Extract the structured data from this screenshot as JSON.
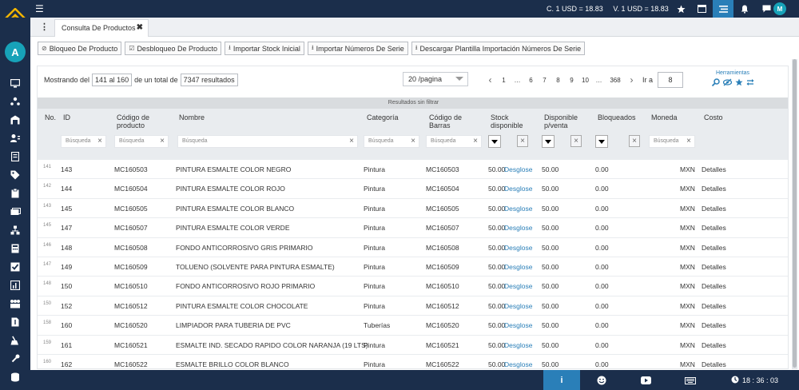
{
  "header": {
    "rate_c": "C. 1 USD = 18.83",
    "rate_v": "V. 1 USD = 18.83",
    "user_initial": "M"
  },
  "sidebar": {
    "user_initial": "A"
  },
  "tabs": [
    {
      "label": "Consulta De Productos"
    }
  ],
  "actions": [
    {
      "label": "Bloqueo De Producto",
      "icon": "ban-icon"
    },
    {
      "label": "Desbloqueo De Producto",
      "icon": "check-square-icon"
    },
    {
      "label": "Importar Stock Inicial",
      "icon": "upload-icon"
    },
    {
      "label": "Importar Números De Serie",
      "icon": "upload-icon"
    },
    {
      "label": "Descargar Plantilla Importación Números De Serie",
      "icon": "download-icon"
    }
  ],
  "pager": {
    "showing_prefix": "Mostrando del",
    "range": "141 al 160",
    "of_total": "de un total de",
    "total": "7347 resultados",
    "per_page": "20 /pagina",
    "prev": "‹",
    "pages": [
      "1",
      "…",
      "6",
      "7",
      "8",
      "9",
      "10",
      "…",
      "368"
    ],
    "next": "›",
    "goto_label": "Ir a",
    "goto_value": "8",
    "tools_label": "Herramientas"
  },
  "filter_status": "Resultados sin filtrar",
  "columns": {
    "no": "No.",
    "id": "ID",
    "code": "Código de producto",
    "name": "Nombre",
    "category": "Categoría",
    "barcode": "Código de Barras",
    "stock": "Stock disponible",
    "available": "Disponible p/venta",
    "blocked": "Bloqueados",
    "currency": "Moneda",
    "cost": "Costo"
  },
  "filters": {
    "placeholder": "Búsqueda"
  },
  "rows": [
    {
      "n": "141",
      "id": "143",
      "code": "MC160503",
      "name": "PINTURA ESMALTE COLOR NEGRO",
      "cat": "Pintura",
      "bar": "MC160503",
      "stock": "50.00",
      "link": "Desglose",
      "avail": "50.00",
      "blk": "0.00",
      "cur": "MXN",
      "cost": "Detalles"
    },
    {
      "n": "142",
      "id": "144",
      "code": "MC160504",
      "name": "PINTURA ESMALTE COLOR ROJO",
      "cat": "Pintura",
      "bar": "MC160504",
      "stock": "50.00",
      "link": "Desglose",
      "avail": "50.00",
      "blk": "0.00",
      "cur": "MXN",
      "cost": "Detalles"
    },
    {
      "n": "143",
      "id": "145",
      "code": "MC160505",
      "name": "PINTURA ESMALTE COLOR BLANCO",
      "cat": "Pintura",
      "bar": "MC160505",
      "stock": "50.00",
      "link": "Desglose",
      "avail": "50.00",
      "blk": "0.00",
      "cur": "MXN",
      "cost": "Detalles"
    },
    {
      "n": "145",
      "id": "147",
      "code": "MC160507",
      "name": "PINTURA ESMALTE COLOR VERDE",
      "cat": "Pintura",
      "bar": "MC160507",
      "stock": "50.00",
      "link": "Desglose",
      "avail": "50.00",
      "blk": "0.00",
      "cur": "MXN",
      "cost": "Detalles"
    },
    {
      "n": "146",
      "id": "148",
      "code": "MC160508",
      "name": "FONDO ANTICORROSIVO GRIS PRIMARIO",
      "cat": "Pintura",
      "bar": "MC160508",
      "stock": "50.00",
      "link": "Desglose",
      "avail": "50.00",
      "blk": "0.00",
      "cur": "MXN",
      "cost": "Detalles"
    },
    {
      "n": "147",
      "id": "149",
      "code": "MC160509",
      "name": "TOLUENO (SOLVENTE PARA PINTURA ESMALTE)",
      "cat": "Pintura",
      "bar": "MC160509",
      "stock": "50.00",
      "link": "Desglose",
      "avail": "50.00",
      "blk": "0.00",
      "cur": "MXN",
      "cost": "Detalles"
    },
    {
      "n": "148",
      "id": "150",
      "code": "MC160510",
      "name": "FONDO ANTICORROSIVO ROJO PRIMARIO",
      "cat": "Pintura",
      "bar": "MC160510",
      "stock": "50.00",
      "link": "Desglose",
      "avail": "50.00",
      "blk": "0.00",
      "cur": "MXN",
      "cost": "Detalles"
    },
    {
      "n": "150",
      "id": "152",
      "code": "MC160512",
      "name": "PINTURA ESMALTE COLOR CHOCOLATE",
      "cat": "Pintura",
      "bar": "MC160512",
      "stock": "50.00",
      "link": "Desglose",
      "avail": "50.00",
      "blk": "0.00",
      "cur": "MXN",
      "cost": "Detalles"
    },
    {
      "n": "158",
      "id": "160",
      "code": "MC160520",
      "name": "LIMPIADOR PARA TUBERIA DE PVC",
      "cat": "Tuberías",
      "bar": "MC160520",
      "stock": "50.00",
      "link": "Desglose",
      "avail": "50.00",
      "blk": "0.00",
      "cur": "MXN",
      "cost": "Detalles"
    },
    {
      "n": "159",
      "id": "161",
      "code": "MC160521",
      "name": "ESMALTE IND. SECADO RAPIDO COLOR NARANJA (19 LTS)",
      "cat": "Pintura",
      "bar": "MC160521",
      "stock": "50.00",
      "link": "Desglose",
      "avail": "50.00",
      "blk": "0.00",
      "cur": "MXN",
      "cost": "Detalles"
    },
    {
      "n": "160",
      "id": "162",
      "code": "MC160522",
      "name": "ESMALTE BRILLO COLOR BLANCO",
      "cat": "Pintura",
      "bar": "MC160522",
      "stock": "50.00",
      "link": "Desglose",
      "avail": "50.00",
      "blk": "0.00",
      "cur": "MXN",
      "cost": "Detalles"
    }
  ],
  "bottom": {
    "info": "i",
    "time": "18 : 36 : 03"
  },
  "colors": {
    "navy": "#1b2e4b",
    "accent": "#2a7fb8",
    "avatar": "#17a2b8"
  }
}
